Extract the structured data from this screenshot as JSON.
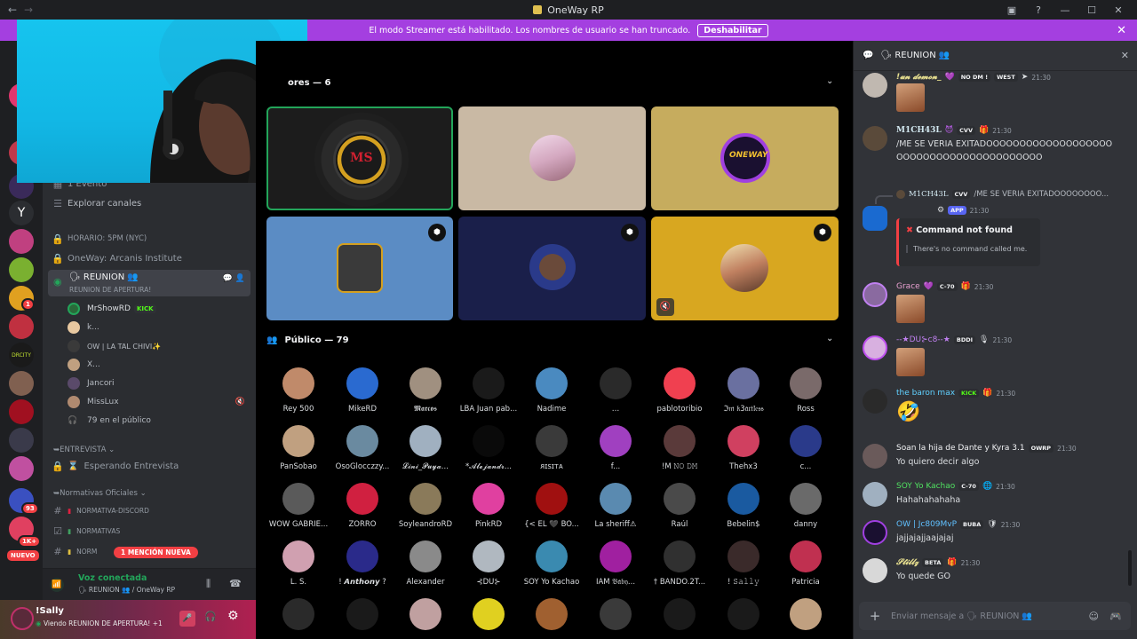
{
  "window": {
    "title": "OneWay RP",
    "back": "←",
    "forward": "→"
  },
  "banner": {
    "text": "El modo Streamer está habilitado. Los nombres de usuario se han truncado.",
    "button": "Deshabilitar"
  },
  "servers": {
    "badges": [
      "1",
      "93",
      "1",
      "1K+"
    ],
    "new_label": "NUEVO"
  },
  "sidebar": {
    "channels": [
      {
        "icon": "calendar-icon",
        "label": "1 Evento"
      },
      {
        "icon": "explore-icon",
        "label": "Explorar canales"
      },
      {
        "icon": "lock-icon",
        "label": "HORARIO: 5PM (NYC)"
      },
      {
        "icon": "lock-icon",
        "label": "OneWay: Arcanis Institute"
      }
    ],
    "active_voice": {
      "name": "REUNION",
      "status": "REUNION DE APERTURA!"
    },
    "voice_users": [
      {
        "name": "MrShowRD",
        "tag": "KICK"
      },
      {
        "name": "k..."
      },
      {
        "name": "OW | LA TAL CHIVI✨"
      },
      {
        "name": "X..."
      },
      {
        "name": "Jancori"
      },
      {
        "name": "MissLux"
      }
    ],
    "audience_count": "79 en el público",
    "category_entrevista": "ENTREVISTA",
    "waiting": "Esperando Entrevista",
    "category_normativas": "Normativas Oficiales",
    "normativa_channels": [
      "NORMATIVA-DISCORD",
      "NORMATIVAS",
      "NORM"
    ],
    "mention_pill": "1 MENCIÓN NUEVA"
  },
  "voice_panel": {
    "title": "Voz conectada",
    "channel": "REUNION",
    "server": "/ OneWay RP"
  },
  "user_panel": {
    "name": "!Sally",
    "status": "Viendo REUNION DE APERTURA! +1"
  },
  "stage": {
    "speakers_title": "ores — 6",
    "audience_title": "Público — 79",
    "audience": [
      "Rey 500",
      "MikeRD",
      "𝕸𝖆𝖗𝖈𝖔𝖘",
      "LBA Juan pab...",
      "Nadime",
      "…",
      "pablotoribio",
      "ℑ𝔪 𝔨3𝔞𝔯𝔱𝔩𝔢𝔰𝔰",
      "Ross",
      "PanSobao",
      "OsoGlocczzy...",
      "𝓛𝓲𝓷𝓲_𝓟𝓾𝔂𝓪...",
      "*𝓐𝓵𝓮𝓳𝓪𝓷𝓭𝓻...",
      "ᴙɪꜱɪᴛᴀ",
      "f...",
      "!M 𝙽𝙾 𝙳𝙼",
      "Thehx3",
      "c...",
      "WOW GABRIE...",
      "ZORRO",
      "SoyleandroRD",
      "PinkRD",
      "{< EL 🖤 BO...",
      "La sheriff⚠",
      "Raúl",
      "Bebelin$",
      "danny",
      "L. S.",
      "! 𝘼𝙣𝙩𝙝𝙤𝙣𝙮 ?",
      "Alexander",
      "⊰DU⊱",
      "SOY Yo Kachao",
      "IAM 𝔅𝔞𝔟𝔶...",
      "† BANDO.2T...",
      "! 𝚂𝚊𝚕𝚕𝚢",
      "Patricia",
      "",
      "",
      "",
      "",
      "",
      "",
      "",
      "",
      ""
    ]
  },
  "chat": {
    "channel": "REUNION",
    "messages": [
      {
        "author": "!𝓾𝓷 𝓭𝓮𝓶𝓸𝓷_",
        "author_color": "#e8e090",
        "tags": [
          "NO DM !",
          "WEST"
        ],
        "time": "21:30",
        "text": ""
      },
      {
        "author": "M1CH43L",
        "author_color": "#d2e8f0",
        "tags": [
          "CVV"
        ],
        "time": "21:30",
        "text": "/ME SE VERIA EXITADOOOOOOOOOOOOOOOOOOOOOOOOOOOOOOOOOOOOOOOOO"
      },
      {
        "author": "",
        "reply_author": "M1CH43L",
        "reply_tag": "CVV",
        "reply_text": "/ME SE VERIA EXITADOOOOOOOO...",
        "app_tag": "APP",
        "time": "21:30",
        "embed_title": "Command not found",
        "embed_text": "There's no command called me."
      },
      {
        "author": "Grace",
        "author_color": "#e8a0d0",
        "tags": [
          "C-70"
        ],
        "time": "21:30",
        "text": ""
      },
      {
        "author": "--★DU⊱c8--★",
        "author_color": "#c080f0",
        "tags": [
          "BDDI"
        ],
        "time": "21:30",
        "text": ""
      },
      {
        "author": "the baron max",
        "author_color": "#60d0ff",
        "tags": [
          "KICK"
        ],
        "time": "21:30",
        "text": "🤣"
      },
      {
        "author": "Soan la hija de Dante y Kyra 3.1",
        "author_color": "#f2f3f5",
        "tags": [
          "OWRP"
        ],
        "time": "21:30",
        "text": "Yo quiero decir algo"
      },
      {
        "author": "SOY Yo Kachao",
        "author_color": "#50e060",
        "tags": [
          "C-70"
        ],
        "time": "21:30",
        "text": "Hahahahahaha"
      },
      {
        "author": "OW | Jc809MvP",
        "author_color": "#60c0ff",
        "tags": [
          "BUBA"
        ],
        "time": "21:30",
        "text": "jajjajajjaajajaj"
      },
      {
        "author": "𝓢𝓽𝓲𝓵𝓵𝔃",
        "author_color": "#e8e090",
        "tags": [
          "BETA"
        ],
        "time": "21:30",
        "text": "Yo quede GO"
      }
    ],
    "input_placeholder": "Enviar mensaje a 🗣 REUNION 👥"
  }
}
